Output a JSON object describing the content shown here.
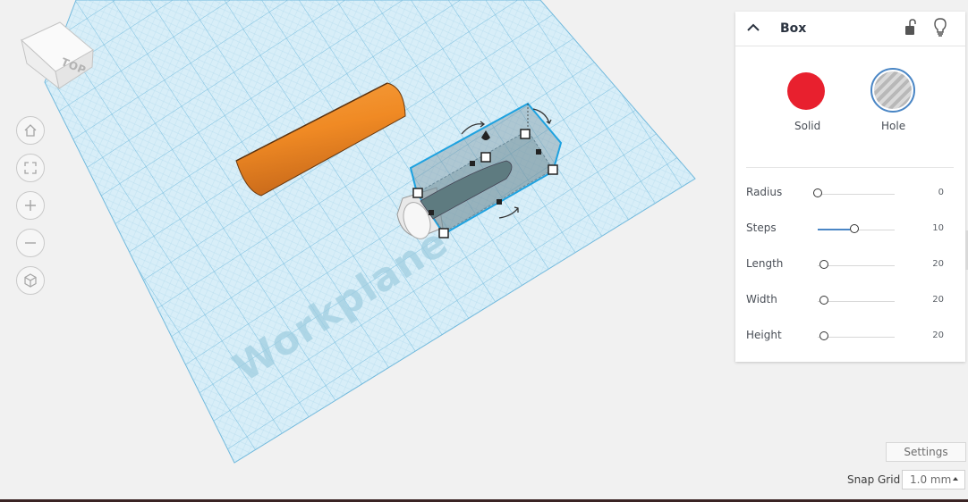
{
  "viewcube": {
    "face_label": "TOP"
  },
  "workplane": {
    "label": "Workplane"
  },
  "nav_buttons": [
    "home-icon",
    "fit-view-icon",
    "zoom-in-icon",
    "zoom-out-icon",
    "perspective-icon"
  ],
  "inspector": {
    "title": "Box",
    "solid_label": "Solid",
    "hole_label": "Hole",
    "solid_color": "#e8202e",
    "selected": "Hole",
    "properties": [
      {
        "label": "Radius",
        "value": "0",
        "level": 0.0
      },
      {
        "label": "Steps",
        "value": "10",
        "level": 0.48
      },
      {
        "label": "Length",
        "value": "20",
        "level": 0.08
      },
      {
        "label": "Width",
        "value": "20",
        "level": 0.08
      },
      {
        "label": "Height",
        "value": "20",
        "level": 0.08
      }
    ]
  },
  "settings_label": "Settings",
  "snap_grid": {
    "label": "Snap Grid",
    "value": "1.0 mm"
  },
  "colors": {
    "accent": "#4a86c5",
    "grid": "#cde8f5",
    "cylinder": "#f08a24"
  }
}
